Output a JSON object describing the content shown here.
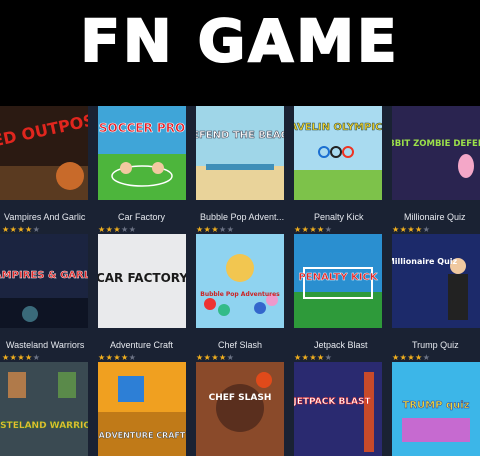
{
  "site": {
    "brand": "FN GAME"
  },
  "games_row1": [
    {
      "art": "RED OUTPOST",
      "name": "Vampires And Garlic",
      "stars": 4.5
    },
    {
      "art": "SOCCER PRO",
      "name": "Car Factory",
      "stars": 3.5
    },
    {
      "art": "DEFEND THE BEACH",
      "name": "Bubble Pop Advent...",
      "stars": 4
    },
    {
      "art": "JAVELIN OLYMPICS",
      "name": "Penalty Kick",
      "stars": 4.5
    },
    {
      "art": "RABBIT ZOMBIE DEFENSE",
      "name": "Millionaire Quiz",
      "stars": 4
    }
  ],
  "games_row2": [
    {
      "art": "VAMPIRES & GARLIC",
      "name": "Wasteland Warriors",
      "stars": 4
    },
    {
      "art": "CAR FACTORY",
      "name": "Adventure Craft",
      "stars": 4.5
    },
    {
      "art": "Bubble Pop Adventures",
      "name": "Chef Slash",
      "stars": 4.5
    },
    {
      "art": "PENALTY KICK",
      "name": "Jetpack Blast",
      "stars": 4.5
    },
    {
      "art": "Millionaire Quiz",
      "name": "Trump Quiz",
      "stars": 4.5
    }
  ],
  "games_row3": [
    {
      "art": "WASTELAND WARRIORS"
    },
    {
      "art": "ADVENTURE CRAFT"
    },
    {
      "art": "CHEF SLASH"
    },
    {
      "art": "JETPACK BLAST"
    },
    {
      "art": "TRUMP quiz"
    }
  ]
}
